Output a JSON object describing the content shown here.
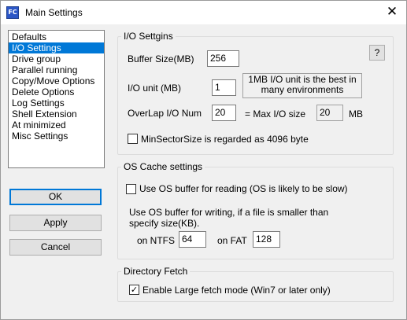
{
  "window": {
    "title": "Main Settings",
    "icon_label": "FC",
    "close_glyph": "✕"
  },
  "nav": {
    "items": [
      "Defaults",
      "I/O Settings",
      "Drive group",
      "Parallel running",
      "Copy/Move Options",
      "Delete Options",
      "Log Settings",
      "Shell Extension",
      "At minimized",
      "Misc Settings"
    ],
    "selected": "I/O Settings"
  },
  "buttons": {
    "ok": "OK",
    "apply": "Apply",
    "cancel": "Cancel",
    "help": "?"
  },
  "io": {
    "legend": "I/O Settgins",
    "buffer_label": "Buffer Size(MB)",
    "buffer_value": "256",
    "unit_label": "I/O unit (MB)",
    "unit_value": "1",
    "unit_note_line1": "1MB I/O unit is the best in",
    "unit_note_line2": "many environments",
    "overlap_label": "OverLap I/O Num",
    "overlap_value": "20",
    "max_label": "= Max I/O size",
    "max_value": "20",
    "max_unit": "MB",
    "minsector_label": "MinSectorSize is regarded as 4096 byte",
    "minsector_checked": false
  },
  "cache": {
    "legend": "OS Cache settings",
    "read_label": "Use OS buffer for reading (OS is likely to be slow)",
    "read_checked": false,
    "write_line1": "Use OS buffer for writing, if a file is smaller than",
    "write_line2": "specify size(KB).",
    "ntfs_label": "on NTFS",
    "ntfs_value": "64",
    "fat_label": "on FAT",
    "fat_value": "128"
  },
  "fetch": {
    "legend": "Directory Fetch",
    "large_label": "Enable Large fetch mode (Win7 or later only)",
    "large_checked": true
  },
  "glyphs": {
    "check": "✓"
  }
}
